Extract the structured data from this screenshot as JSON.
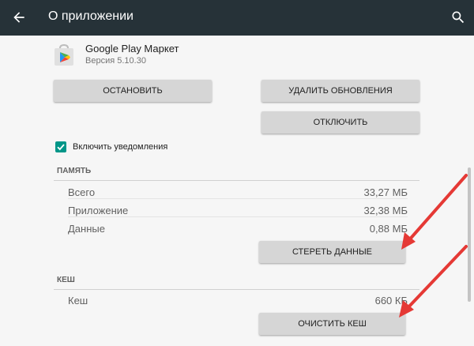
{
  "appbar": {
    "title": "О приложении",
    "back_icon": "arrow-back-icon",
    "search_icon": "search-icon",
    "background": "#263238"
  },
  "app": {
    "name": "Google Play Маркет",
    "version": "Версия 5.10.30"
  },
  "buttons": {
    "stop": "ОСТАНОВИТЬ",
    "uninstall_updates": "УДАЛИТЬ ОБНОВЛЕНИЯ",
    "disable": "ОТКЛЮЧИТЬ",
    "clear_data": "СТЕРЕТЬ ДАННЫЕ",
    "clear_cache": "ОЧИСТИТЬ КЕШ"
  },
  "notifications": {
    "label": "Включить уведомления",
    "checked": true,
    "accent": "#009688"
  },
  "memory": {
    "header": "ПАМЯТЬ",
    "rows": [
      {
        "label": "Всего",
        "value": "33,27 МБ"
      },
      {
        "label": "Приложение",
        "value": "32,38 МБ"
      },
      {
        "label": "Данные",
        "value": "0,88 МБ"
      }
    ]
  },
  "cache": {
    "header": "КЕШ",
    "rows": [
      {
        "label": "Кеш",
        "value": "660 КБ"
      }
    ]
  },
  "annotation_color": "#e53935"
}
